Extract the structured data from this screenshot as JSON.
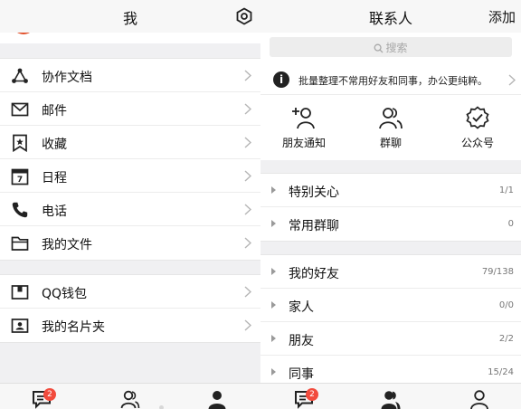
{
  "me": {
    "header": {
      "title": "我",
      "settings_icon": "settings-hexagon-icon"
    },
    "group1": [
      {
        "label": "协作文档",
        "icon": "share-nodes-icon"
      },
      {
        "label": "邮件",
        "icon": "mail-icon"
      },
      {
        "label": "收藏",
        "icon": "bookmark-icon"
      },
      {
        "label": "日程",
        "icon": "calendar-icon"
      },
      {
        "label": "电话",
        "icon": "phone-icon"
      },
      {
        "label": "我的文件",
        "icon": "folder-icon"
      }
    ],
    "group2": [
      {
        "label": "QQ钱包",
        "icon": "wallet-icon"
      },
      {
        "label": "我的名片夹",
        "icon": "card-holder-icon"
      }
    ],
    "tabbar": {
      "messages_badge": "2"
    }
  },
  "contacts": {
    "header": {
      "title": "联系人",
      "add_label": "添加"
    },
    "search": {
      "placeholder": "搜索"
    },
    "notice": {
      "text": "批量整理不常用好友和同事，办公更纯粹。"
    },
    "quick": [
      {
        "label": "朋友通知",
        "icon": "add-friend-icon"
      },
      {
        "label": "群聊",
        "icon": "group-chat-icon"
      },
      {
        "label": "公众号",
        "icon": "verified-badge-icon"
      }
    ],
    "groups1": [
      {
        "name": "特别关心",
        "count": "1/1"
      },
      {
        "name": "常用群聊",
        "count": "0"
      }
    ],
    "groups2": [
      {
        "name": "我的好友",
        "count": "79/138"
      },
      {
        "name": "家人",
        "count": "0/0"
      },
      {
        "name": "朋友",
        "count": "2/2"
      },
      {
        "name": "同事",
        "count": "15/24"
      }
    ],
    "tabbar": {
      "messages_badge": "2"
    }
  },
  "colors": {
    "badge": "#f24b3d",
    "background": "#f0f0f2",
    "icon": "#222222"
  }
}
